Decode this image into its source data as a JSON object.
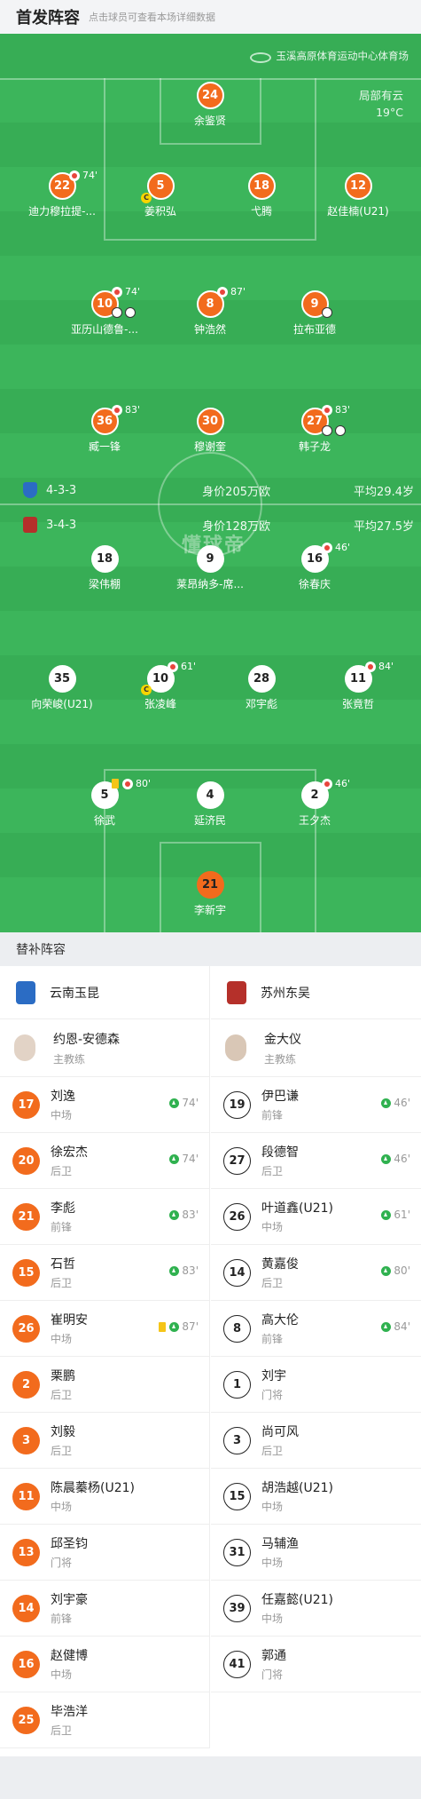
{
  "header": {
    "title": "首发阵容",
    "subtitle": "点击球员可查看本场详细数据"
  },
  "venue": {
    "name": "玉溪高原体育运动中心体育场",
    "icon": "stadium-icon"
  },
  "weather": {
    "condition": "局部有云",
    "temperature": "19°C"
  },
  "watermark": "懂球帝",
  "home_team": {
    "name": "云南玉昆",
    "formation": "4-3-3",
    "value": "身价205万欧",
    "avg_age": "平均29.4岁",
    "color": "#f26b1d",
    "lineup": [
      {
        "num": "24",
        "name": "余鉴贤"
      },
      {
        "num": "22",
        "name": "迪力穆拉提-...",
        "sub_time": "74'"
      },
      {
        "num": "5",
        "name": "姜积弘",
        "captain": "C"
      },
      {
        "num": "18",
        "name": "弋腾"
      },
      {
        "num": "12",
        "name": "赵佳楠(U21)"
      },
      {
        "num": "10",
        "name": "亚历山德鲁-...",
        "sub_time": "74'"
      },
      {
        "num": "8",
        "name": "钟浩然",
        "sub_time": "87'"
      },
      {
        "num": "9",
        "name": "拉布亚德"
      },
      {
        "num": "36",
        "name": "臧一锋",
        "sub_time": "83'"
      },
      {
        "num": "30",
        "name": "穆谢奎"
      },
      {
        "num": "27",
        "name": "韩子龙",
        "sub_time": "83'"
      }
    ]
  },
  "away_team": {
    "name": "苏州东吴",
    "formation": "3-4-3",
    "value": "身价128万欧",
    "avg_age": "平均27.5岁",
    "lineup": [
      {
        "num": "18",
        "name": "梁伟棚"
      },
      {
        "num": "9",
        "name": "莱昂纳多-席..."
      },
      {
        "num": "16",
        "name": "徐春庆",
        "sub_time": "46'"
      },
      {
        "num": "35",
        "name": "向荣峻(U21)"
      },
      {
        "num": "10",
        "name": "张凌峰",
        "sub_time": "61'",
        "captain": "C"
      },
      {
        "num": "28",
        "name": "邓宇彪"
      },
      {
        "num": "11",
        "name": "张竟哲",
        "sub_time": "84'"
      },
      {
        "num": "5",
        "name": "徐武",
        "sub_time": "80'"
      },
      {
        "num": "4",
        "name": "延济民"
      },
      {
        "num": "2",
        "name": "王夕杰",
        "sub_time": "46'"
      },
      {
        "num": "21",
        "name": "李新宇"
      }
    ]
  },
  "subs": {
    "title": "替补阵容",
    "home": {
      "team": "云南玉昆",
      "coach": {
        "name": "约恩-安德森",
        "role": "主教练"
      },
      "players": [
        {
          "num": "17",
          "name": "刘逸",
          "pos": "中场",
          "time": "74'"
        },
        {
          "num": "20",
          "name": "徐宏杰",
          "pos": "后卫",
          "time": "74'"
        },
        {
          "num": "21",
          "name": "李彪",
          "pos": "前锋",
          "time": "83'"
        },
        {
          "num": "15",
          "name": "石哲",
          "pos": "后卫",
          "time": "83'"
        },
        {
          "num": "26",
          "name": "崔明安",
          "pos": "中场",
          "time": "87'",
          "card": "yellow"
        },
        {
          "num": "2",
          "name": "栗鹏",
          "pos": "后卫"
        },
        {
          "num": "3",
          "name": "刘毅",
          "pos": "后卫"
        },
        {
          "num": "11",
          "name": "陈晨蓁杨(U21)",
          "pos": "中场"
        },
        {
          "num": "13",
          "name": "邱圣钧",
          "pos": "门将"
        },
        {
          "num": "14",
          "name": "刘宇豪",
          "pos": "前锋"
        },
        {
          "num": "16",
          "name": "赵健博",
          "pos": "中场"
        },
        {
          "num": "25",
          "name": "毕浩洋",
          "pos": "后卫"
        }
      ]
    },
    "away": {
      "team": "苏州东吴",
      "coach": {
        "name": "金大仪",
        "role": "主教练"
      },
      "players": [
        {
          "num": "19",
          "name": "伊巴谦",
          "pos": "前锋",
          "time": "46'"
        },
        {
          "num": "27",
          "name": "段德智",
          "pos": "后卫",
          "time": "46'"
        },
        {
          "num": "26",
          "name": "叶道鑫(U21)",
          "pos": "中场",
          "time": "61'"
        },
        {
          "num": "14",
          "name": "黄嘉俊",
          "pos": "后卫",
          "time": "80'"
        },
        {
          "num": "8",
          "name": "高大伦",
          "pos": "前锋",
          "time": "84'"
        },
        {
          "num": "1",
          "name": "刘宇",
          "pos": "门将"
        },
        {
          "num": "3",
          "name": "尚可风",
          "pos": "后卫"
        },
        {
          "num": "15",
          "name": "胡浩越(U21)",
          "pos": "中场"
        },
        {
          "num": "31",
          "name": "马辅渔",
          "pos": "中场"
        },
        {
          "num": "39",
          "name": "任嘉懿(U21)",
          "pos": "中场"
        },
        {
          "num": "41",
          "name": "郭通",
          "pos": "门将"
        }
      ]
    }
  }
}
